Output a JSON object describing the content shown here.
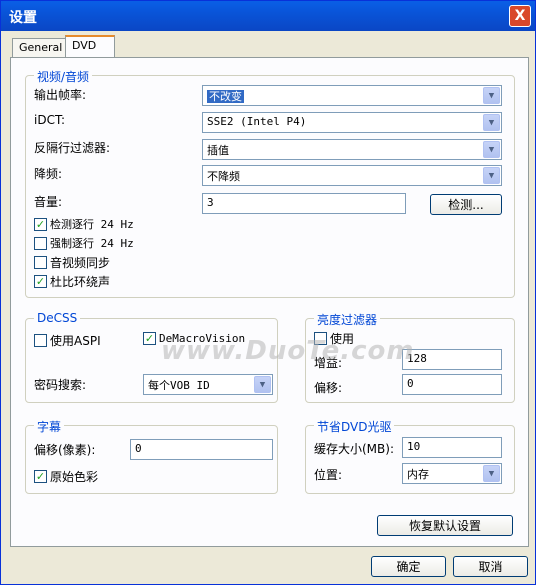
{
  "window": {
    "title": "设置",
    "close_label": "X"
  },
  "tabs": [
    {
      "label": "General"
    },
    {
      "label": "DVD"
    }
  ],
  "video_audio": {
    "title": "视频/音频",
    "output_fps_label": "输出帧率:",
    "output_fps_value": "不改变",
    "idct_label": "iDCT:",
    "idct_value": "SSE2 (Intel P4)",
    "deinterlace_label": "反隔行过滤器:",
    "deinterlace_value": "插值",
    "downsample_label": "降频:",
    "downsample_value": "不降频",
    "volume_label": "音量:",
    "volume_value": "3",
    "detect_button": "检测...",
    "checks": [
      {
        "label": "检测逐行 24 Hz",
        "checked": true
      },
      {
        "label": "强制逐行 24 Hz",
        "checked": false
      },
      {
        "label": "音视频同步",
        "checked": false
      },
      {
        "label": "杜比环绕声",
        "checked": true
      }
    ]
  },
  "decss": {
    "title": "DeCSS",
    "use_aspi": {
      "label": "使用ASPI",
      "checked": false
    },
    "demacrovision": {
      "label": "DeMacroVision",
      "checked": true
    },
    "key_search_label": "密码搜索:",
    "key_search_value": "每个VOB ID"
  },
  "brightness": {
    "title": "亮度过滤器",
    "use": {
      "label": "使用",
      "checked": false
    },
    "gain_label": "增益:",
    "gain_value": "128",
    "offset_label": "偏移:",
    "offset_value": "0"
  },
  "subtitle": {
    "title": "字幕",
    "offset_label": "偏移(像素):",
    "offset_value": "0",
    "original_color": {
      "label": "原始色彩",
      "checked": true
    }
  },
  "save_dvd": {
    "title": "节省DVD光驱",
    "cache_label": "缓存大小(MB):",
    "cache_value": "10",
    "location_label": "位置:",
    "location_value": "内存"
  },
  "buttons": {
    "restore": "恢复默认设置",
    "ok": "确定",
    "cancel": "取消"
  },
  "watermark": "www.DuoTe.com"
}
